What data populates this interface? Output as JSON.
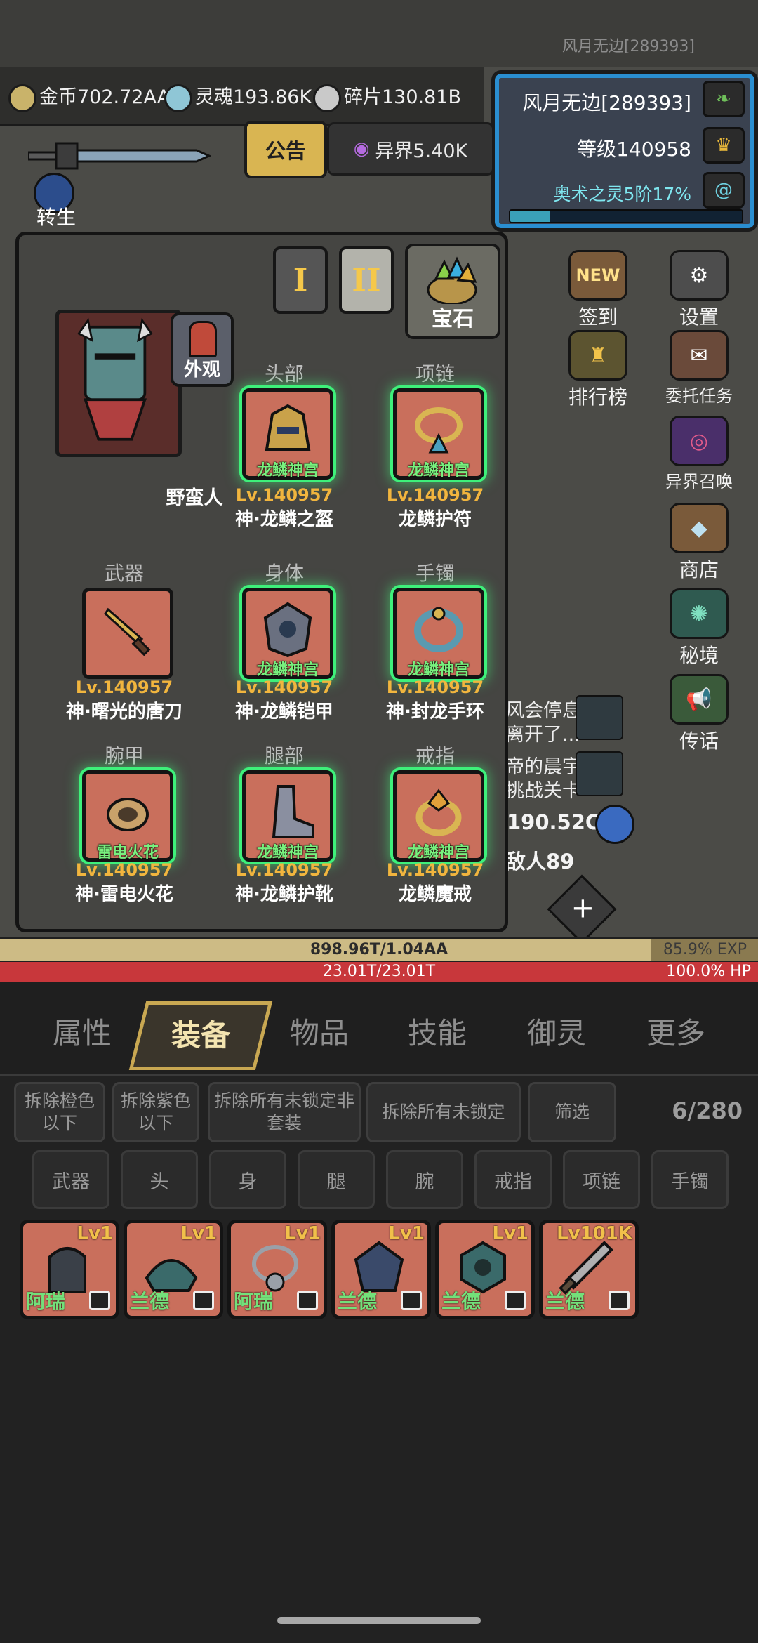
{
  "header": {
    "top_player_tag": "风月无边[289393]"
  },
  "resources": [
    {
      "icon": "gold-coin-icon",
      "label": "金币702.72AA"
    },
    {
      "icon": "soul-icon",
      "label": "灵魂193.86K"
    },
    {
      "icon": "fragment-icon",
      "label": "碎片130.81B"
    }
  ],
  "player": {
    "name": "风月无边[289393]",
    "level_label": "等级140958",
    "arcane_label": "奥术之灵5阶17%",
    "arcane_progress": 0.17
  },
  "top_buttons": {
    "notice": "公告",
    "otherworld": "异界5.40K",
    "rebirth": "转生"
  },
  "side_menu": [
    {
      "label": "签到",
      "badge": "NEW",
      "icon": "sign-in-icon"
    },
    {
      "label": "设置",
      "icon": "gear-icon"
    },
    {
      "label": "排行榜",
      "icon": "trophy-icon"
    },
    {
      "label": "委托任务",
      "icon": "quest-icon"
    },
    {
      "label": "异界召唤",
      "icon": "summon-portal-icon"
    },
    {
      "label": "商店",
      "icon": "shop-bag-icon"
    },
    {
      "label": "秘境",
      "icon": "secret-realm-icon"
    },
    {
      "label": "传话",
      "icon": "megaphone-icon"
    }
  ],
  "chat": [
    {
      "text": "风会停息"
    },
    {
      "text": "离开了..."
    },
    {
      "text": "帝的晨宇"
    },
    {
      "text": "挑战关卡"
    }
  ],
  "battle": {
    "power": "190.52CC",
    "enemy": "敌人89"
  },
  "equip_panel": {
    "set_buttons": [
      "I",
      "II"
    ],
    "gem_label": "宝石",
    "skin_label": "外观",
    "character_name": "野蛮人",
    "slots": [
      {
        "title": "头部",
        "set": "龙鳞神宫",
        "level": "Lv.140957",
        "name": "神·龙鳞之盔"
      },
      {
        "title": "项链",
        "set": "龙鳞神宫",
        "level": "Lv.140957",
        "name": "龙鳞护符"
      },
      {
        "title": "武器",
        "set": "",
        "level": "Lv.140957",
        "name": "神·曙光的唐刀"
      },
      {
        "title": "身体",
        "set": "龙鳞神宫",
        "level": "Lv.140957",
        "name": "神·龙鳞铠甲"
      },
      {
        "title": "手镯",
        "set": "龙鳞神宫",
        "level": "Lv.140957",
        "name": "神·封龙手环"
      },
      {
        "title": "腕甲",
        "set": "雷电火花",
        "level": "Lv.140957",
        "name": "神·雷电火花"
      },
      {
        "title": "腿部",
        "set": "龙鳞神宫",
        "level": "Lv.140957",
        "name": "神·龙鳞护靴"
      },
      {
        "title": "戒指",
        "set": "龙鳞神宫",
        "level": "Lv.140957",
        "name": "龙鳞魔戒"
      }
    ]
  },
  "bars": {
    "exp_text": "898.96T/1.04AA",
    "exp_pct": "85.9% EXP",
    "exp_fraction": 0.859,
    "hp_text": "23.01T/23.01T",
    "hp_pct": "100.0%   HP",
    "hp_fraction": 1.0
  },
  "tabs": [
    {
      "label": "属性",
      "active": false
    },
    {
      "label": "装备",
      "active": true
    },
    {
      "label": "物品",
      "active": false
    },
    {
      "label": "技能",
      "active": false
    },
    {
      "label": "御灵",
      "active": false
    },
    {
      "label": "更多",
      "active": false
    }
  ],
  "inventory": {
    "actions": [
      {
        "label": "拆除橙色以下"
      },
      {
        "label": "拆除紫色以下"
      },
      {
        "label": "拆除所有未锁定非套装"
      },
      {
        "label": "拆除所有未锁定"
      },
      {
        "label": "筛选"
      }
    ],
    "count": "6/280",
    "filters": [
      "武器",
      "头",
      "身",
      "腿",
      "腕",
      "戒指",
      "项链",
      "手镯"
    ],
    "items": [
      {
        "level": "Lv1",
        "tag": "阿瑞"
      },
      {
        "level": "Lv1",
        "tag": "兰德"
      },
      {
        "level": "Lv1",
        "tag": "阿瑞"
      },
      {
        "level": "Lv1",
        "tag": "兰德"
      },
      {
        "level": "Lv1",
        "tag": "兰德"
      },
      {
        "level": "Lv101K",
        "tag": "兰德"
      }
    ]
  }
}
